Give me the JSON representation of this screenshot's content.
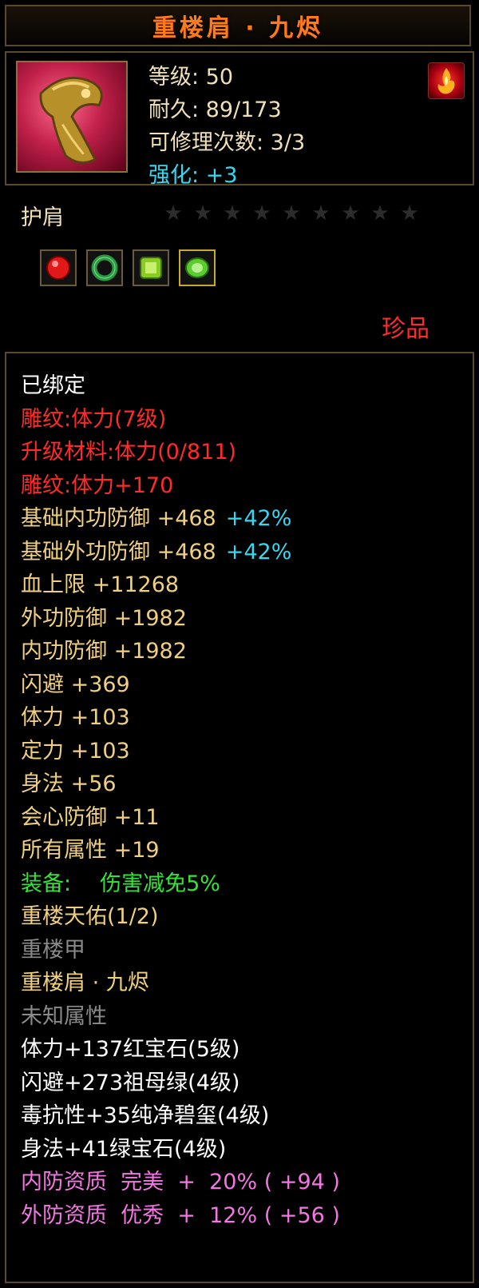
{
  "item": {
    "name": "重楼肩 · 九烬",
    "level_label": "等级: 50",
    "durability_label": "耐久: 89/173",
    "repair_label": "可修理次数: 3/3",
    "enhance_label": "强化: +3",
    "type": "护肩",
    "rarity": "珍品",
    "star_count": 9,
    "icon": "gold-shoulder-armor-icon",
    "badge_icon": "flame-badge-icon"
  },
  "gems": [
    {
      "icon": "red-ruby-gem-icon",
      "color": "#e01818"
    },
    {
      "icon": "green-jade-ring-icon",
      "color": "#2a9a40"
    },
    {
      "icon": "green-square-gem-icon",
      "color": "#88cc20"
    },
    {
      "icon": "emerald-gem-icon",
      "color": "#5acc30"
    }
  ],
  "attributes": {
    "bound": "已绑定",
    "carve1": "雕纹:体力(7级)",
    "upgrade": "升级材料:体力(0/811)",
    "carve2": "雕纹:体力+170",
    "inner_def": "基础内功防御 +468",
    "inner_def_pct": "+42%",
    "outer_def": "基础外功防御 +468",
    "outer_def_pct": "+42%",
    "hp": "血上限 +11268",
    "outer_defense": "外功防御 +1982",
    "inner_defense": "内功防御 +1982",
    "dodge": "闪避 +369",
    "stamina": "体力 +103",
    "focus": "定力 +103",
    "agility": "身法 +56",
    "crit_def": "会心防御 +11",
    "all_attr": "所有属性 +19",
    "equip_label": "装备:",
    "equip_effect": "伤害减免5%",
    "set_name": "重楼天佑(1/2)",
    "set_item1": "重楼甲",
    "set_item2": "重楼肩 · 九烬",
    "unknown": "未知属性",
    "gem1": "体力+137红宝石(5级)",
    "gem2": "闪避+273祖母绿(4级)",
    "gem3": "毒抗性+35纯净碧玺(4级)",
    "gem4": "身法+41绿宝石(4级)",
    "quality1": "内防资质  完美  +  20% ( +94 )",
    "quality2": "外防资质  优秀  +  12% ( +56 )"
  },
  "colors": {
    "title": "#ff7a1a",
    "white": "#ffffff",
    "red": "#ff2a2a",
    "gold": "#f0d080",
    "cyan": "#36d7f0",
    "green": "#36e23a",
    "grey": "#8a8a8a",
    "pink": "#f078e0"
  }
}
